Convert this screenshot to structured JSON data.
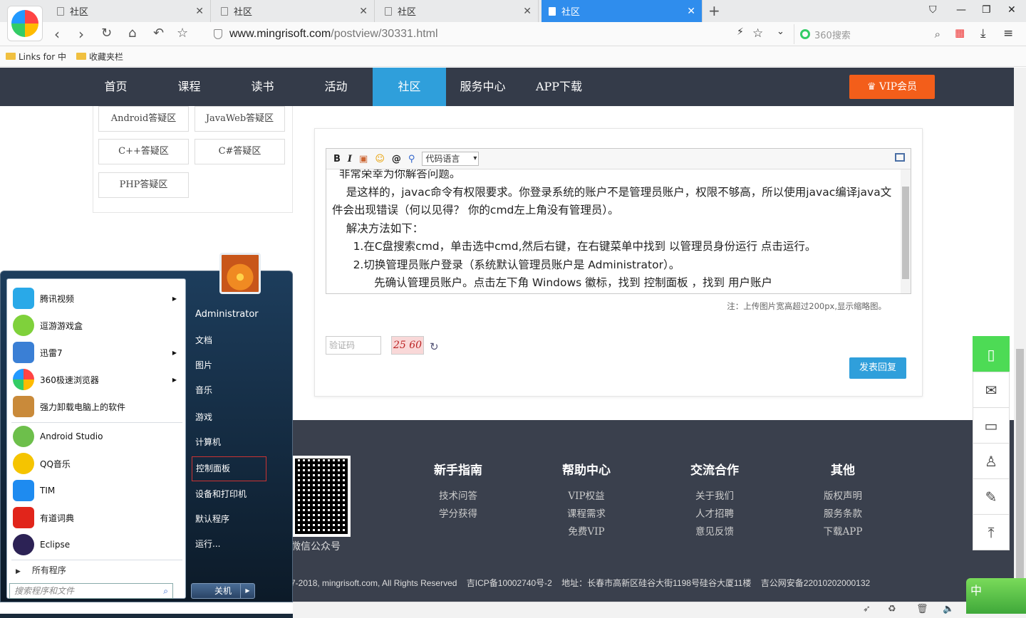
{
  "browser": {
    "tabs": [
      {
        "label": "社区",
        "active": false
      },
      {
        "label": "社区",
        "active": false
      },
      {
        "label": "社区",
        "active": false
      },
      {
        "label": "社区",
        "active": true
      }
    ],
    "url_host": "www.mingrisoft.com",
    "url_path": "/postview/30331.html",
    "search_placeholder": "360搜索",
    "bookmarks": [
      "Links for 中",
      "收藏夹栏"
    ]
  },
  "site_nav": {
    "items": [
      "首页",
      "课程",
      "读书",
      "活动",
      "社区",
      "服务中心",
      "APP下载"
    ],
    "active_index": 4,
    "vip_label": "VIP会员"
  },
  "categories": [
    "Android答疑区",
    "JavaWeb答疑区",
    "C++答疑区",
    "C#答疑区",
    "PHP答疑区"
  ],
  "editor": {
    "select_label": "代码语言",
    "paragraphs": [
      "  非常荣幸为你解答问题。",
      "    是这样的，javac命令有权限要求。你登录系统的账户不是管理员账户，权限不够高，所以使用javac编译java文件会出现错误（何以见得？ 你的cmd左上角没有管理员）。",
      "    解决方法如下：",
      "      1.在C盘搜索cmd，单击选中cmd,然后右键，在右键菜单中找到 以管理员身份运行 点击运行。",
      "      2.切换管理员账户登录（系统默认管理员账户是 Administrator）。",
      "            先确认管理员账户。点击左下角 Windows 徽标，找到 控制面板 ，找到 用户账户"
    ],
    "note": "注：上传图片宽高超过200px,显示缩略图。",
    "captcha_placeholder": "验证码",
    "captcha_text": "25 60",
    "submit_label": "发表回复"
  },
  "footer": {
    "qr_caption": "微信公众号",
    "columns": [
      {
        "title": "新手指南",
        "links": [
          "技术问答",
          "学分获得"
        ]
      },
      {
        "title": "帮助中心",
        "links": [
          "VIP权益",
          "课程需求",
          "免费VIP"
        ]
      },
      {
        "title": "交流合作",
        "links": [
          "关于我们",
          "人才招聘",
          "意见反馈"
        ]
      },
      {
        "title": "其他",
        "links": [
          "版权声明",
          "服务条款",
          "下载APP"
        ]
      }
    ],
    "copyright": "7-2018, mingrisoft.com, All Rights Reserved    吉ICP备10002740号-2    地址：长春市高新区硅谷大街1198号硅谷大厦11楼    吉公网安备22010202000132"
  },
  "start_menu": {
    "programs": [
      {
        "label": "腾讯视频",
        "arrow": true,
        "color": "#29a9e8"
      },
      {
        "label": "逗游游戏盒",
        "arrow": false,
        "color": "#7fd13b"
      },
      {
        "label": "迅雷7",
        "arrow": true,
        "color": "#3a7fd5"
      },
      {
        "label": "360极速浏览器",
        "arrow": true,
        "color": "#f2b02a"
      },
      {
        "label": "强力卸载电脑上的软件",
        "arrow": false,
        "color": "#c98a3a"
      },
      {
        "label": "Android Studio",
        "arrow": false,
        "color": "#6dbf4b"
      },
      {
        "label": "QQ音乐",
        "arrow": false,
        "color": "#f5c400"
      },
      {
        "label": "TIM",
        "arrow": false,
        "color": "#1e8bf0"
      },
      {
        "label": "有道词典",
        "arrow": false,
        "color": "#e1251b"
      },
      {
        "label": "Eclipse",
        "arrow": false,
        "color": "#2c2255"
      }
    ],
    "all_programs": "所有程序",
    "search_placeholder": "搜索程序和文件",
    "right_items": [
      "Administrator",
      "文档",
      "图片",
      "音乐",
      "游戏",
      "计算机",
      "控制面板",
      "设备和打印机",
      "默认程序",
      "运行..."
    ],
    "highlighted_index": 6,
    "shutdown_label": "关机"
  },
  "ime_label": "中"
}
